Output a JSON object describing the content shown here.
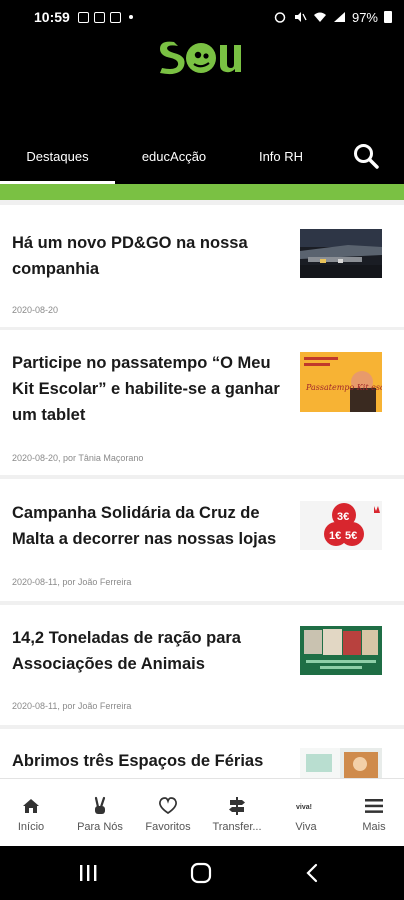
{
  "status_bar": {
    "time": "10:59",
    "battery": "97%"
  },
  "app": {
    "logo_text": "sou",
    "brand_color": "#7ac143"
  },
  "tabs": [
    {
      "label": "Destaques",
      "active": true
    },
    {
      "label": "educAcção",
      "active": false
    },
    {
      "label": "Info RH",
      "active": false
    }
  ],
  "search": {
    "icon": "search-icon"
  },
  "articles": [
    {
      "title": "Há um novo PD&GO na nossa companhia",
      "meta": "2020-08-20"
    },
    {
      "title": "Participe no passatempo “O Meu Kit Escolar” e habilite-se a ganhar um tablet",
      "meta": "2020-08-20, por Tânia Maçorano",
      "thumb_text": "Passatempo Kit escolar"
    },
    {
      "title": "Campanha Solidária da Cruz de Malta a decorrer nas nossas lojas",
      "meta": "2020-08-11, por João Ferreira",
      "thumb_text_1": "3€",
      "thumb_text_2": "1€",
      "thumb_text_3": "5€"
    },
    {
      "title": "14,2 Toneladas de ração para Associações de Animais",
      "meta": "2020-08-11, por João Ferreira"
    },
    {
      "title": "Abrimos três Espaços de Férias",
      "meta": ""
    }
  ],
  "bottom_nav": [
    {
      "label": "Início",
      "icon": "home-icon"
    },
    {
      "label": "Para Nós",
      "icon": "peace-hand-icon"
    },
    {
      "label": "Favoritos",
      "icon": "heart-icon"
    },
    {
      "label": "Transfer...",
      "icon": "signpost-icon"
    },
    {
      "label": "Viva",
      "icon": "viva-icon",
      "icon_text": "viva!"
    },
    {
      "label": "Mais",
      "icon": "menu-icon"
    }
  ]
}
